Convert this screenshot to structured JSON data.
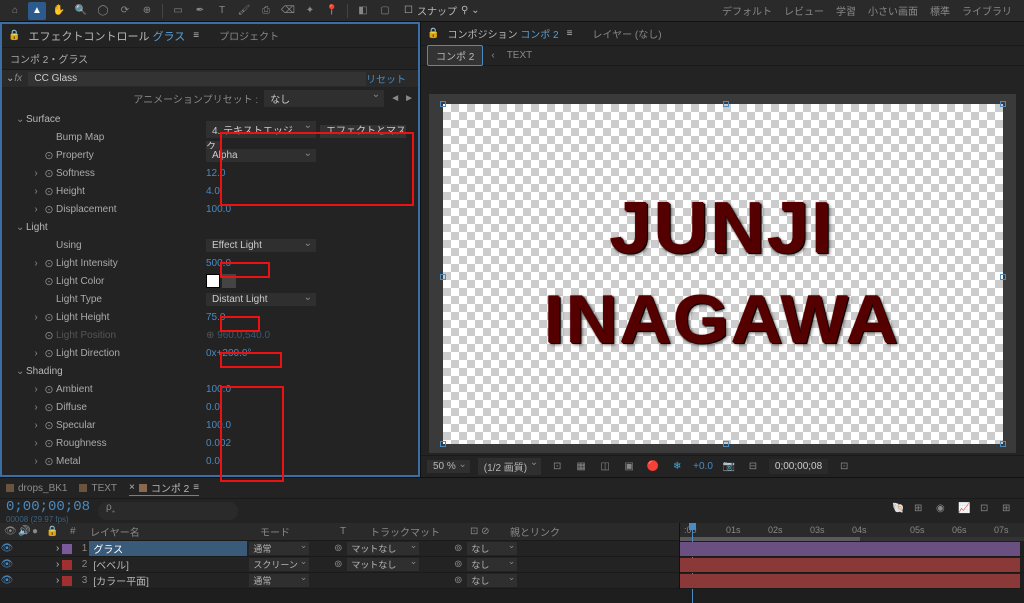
{
  "toolbar": {
    "snap_label": "スナップ",
    "workspaces": [
      "デフォルト",
      "レビュー",
      "学習",
      "小さい画面",
      "標準",
      "ライブラリ"
    ]
  },
  "effect_panel": {
    "title_prefix": "エフェクトコントロール",
    "title_active": "グラス",
    "menu_icon": "≡",
    "project_tab": "プロジェクト",
    "subtitle": "コンポ 2・グラス",
    "effect_name": "CC Glass",
    "reset": "リセット",
    "preset_label": "アニメーションプリセット :",
    "preset_value": "なし",
    "groups": {
      "surface": {
        "label": "Surface",
        "bump_map": {
          "label": "Bump Map",
          "value": "4. テキストエッジ",
          "side": "エフェクトとマスク"
        },
        "property": {
          "label": "Property",
          "value": "Alpha"
        },
        "softness": {
          "label": "Softness",
          "value": "12.0"
        },
        "height": {
          "label": "Height",
          "value": "4.0"
        },
        "displacement": {
          "label": "Displacement",
          "value": "100.0"
        }
      },
      "light": {
        "label": "Light",
        "using": {
          "label": "Using",
          "value": "Effect Light"
        },
        "intensity": {
          "label": "Light Intensity",
          "value": "500.0"
        },
        "color": {
          "label": "Light Color"
        },
        "type": {
          "label": "Light Type",
          "value": "Distant Light"
        },
        "height": {
          "label": "Light Height",
          "value": "75.0"
        },
        "position": {
          "label": "Light Position",
          "value": "960.0,540.0"
        },
        "direction": {
          "label": "Light Direction",
          "value": "0x+200.0°"
        }
      },
      "shading": {
        "label": "Shading",
        "ambient": {
          "label": "Ambient",
          "value": "100.0"
        },
        "diffuse": {
          "label": "Diffuse",
          "value": "0.0"
        },
        "specular": {
          "label": "Specular",
          "value": "100.0"
        },
        "roughness": {
          "label": "Roughness",
          "value": "0.002"
        },
        "metal": {
          "label": "Metal",
          "value": "0.0"
        }
      }
    }
  },
  "comp_panel": {
    "title_prefix": "コンポジション",
    "title_active": "コンポ 2",
    "layer_tab": "レイヤー (なし)",
    "tab_active": "コンポ 2",
    "tab_crumb": "TEXT",
    "text_line1": "JUNJI",
    "text_line2": "INAGAWA",
    "viewer": {
      "zoom": "50 %",
      "res": "(1/2 画質)",
      "exposure": "+0.0",
      "timecode": "0;00;00;08"
    }
  },
  "timeline": {
    "tabs": [
      {
        "name": "drops_BK1"
      },
      {
        "name": "TEXT"
      },
      {
        "name": "コンポ 2",
        "active": true
      }
    ],
    "timecode": "0;00;00;08",
    "timecode_sub": "00008 (29.97 fps)",
    "search_ph": "ρ‸",
    "cols": {
      "num": "#",
      "name": "レイヤー名",
      "mode": "モード",
      "t": "T",
      "track": "トラックマット",
      "parent": "親とリンク"
    },
    "layers": [
      {
        "num": "1",
        "name": "グラス",
        "color": "purple",
        "mode": "通常",
        "track": "マットなし",
        "parent": "なし",
        "selected": true
      },
      {
        "num": "2",
        "name": "[ベベル]",
        "color": "red",
        "mode": "スクリーン",
        "track": "マットなし",
        "parent": "なし"
      },
      {
        "num": "3",
        "name": "[カラー平面]",
        "color": "red",
        "mode": "通常",
        "track": "",
        "parent": "なし"
      }
    ],
    "ruler": [
      "100f",
      ":00",
      "01s",
      "02s",
      "03s",
      "04s",
      "05s",
      "06s",
      "07s"
    ]
  }
}
